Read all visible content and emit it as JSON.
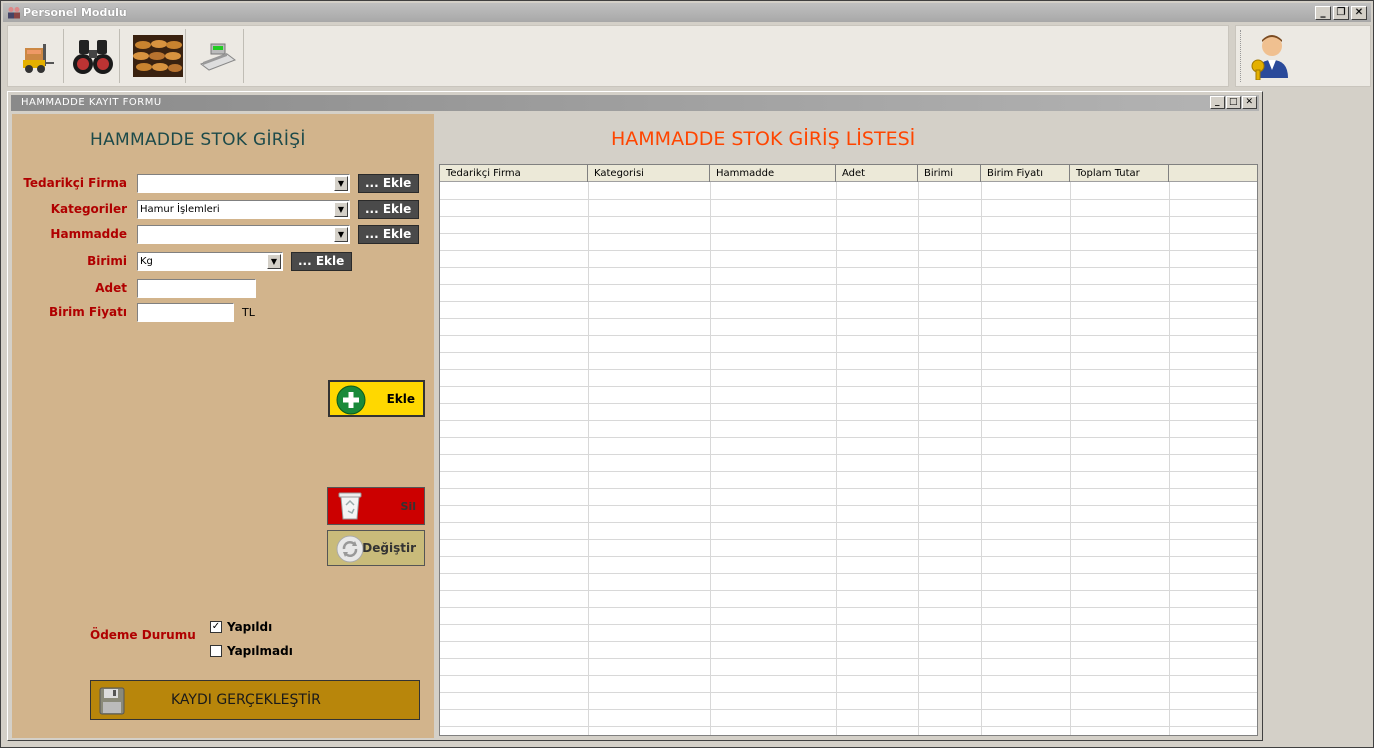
{
  "window": {
    "title": "Personel Modulu",
    "buttons": [
      "_",
      "❐",
      "✕"
    ]
  },
  "toolbar": {
    "items": [
      "forklift-icon",
      "binoculars-icon",
      "bread-photo",
      "cash-register-icon"
    ],
    "user_icon": "user-key-icon"
  },
  "mdi": {
    "title": "HAMMADDE KAYIT FORMU",
    "buttons": [
      "_",
      "□",
      "✕"
    ]
  },
  "form": {
    "title": "HAMMADDE STOK GİRİŞİ",
    "fields": {
      "tedarikci_label": "Tedarikçi Firma",
      "tedarikci_value": "",
      "kategoriler_label": "Kategoriler",
      "kategoriler_value": "Hamur İşlemleri",
      "hammadde_label": "Hammadde",
      "hammadde_value": "",
      "birimi_label": "Birimi",
      "birimi_value": "Kg",
      "adet_label": "Adet",
      "adet_value": "",
      "birim_fiyati_label": "Birim Fiyatı",
      "birim_fiyati_value": "",
      "currency": "TL"
    },
    "small_add_label": "...  Ekle",
    "add_button": "Ekle",
    "delete_button": "Sil",
    "change_button": "Değiştir",
    "odeme_label": "Ödeme Durumu",
    "yapildi_label": "Yapıldı",
    "yapildi_checked": true,
    "yapilmadi_label": "Yapılmadı",
    "yapilmadi_checked": false,
    "save_button": "KAYDI GERÇEKLEŞTİR"
  },
  "list": {
    "title": "HAMMADDE STOK GİRİŞ  LİSTESİ",
    "columns": [
      "Tedarikçi Firma",
      "Kategorisi",
      "Hammadde",
      "Adet",
      "Birimi",
      "Birim Fiyatı",
      "Toplam Tutar"
    ],
    "rows": []
  },
  "colors": {
    "form_bg": "#d2b48c",
    "label": "#b00000",
    "list_title": "#ff4500",
    "add_button": "#ffd800",
    "delete_button": "#cc0000",
    "save_button": "#b8860b"
  }
}
